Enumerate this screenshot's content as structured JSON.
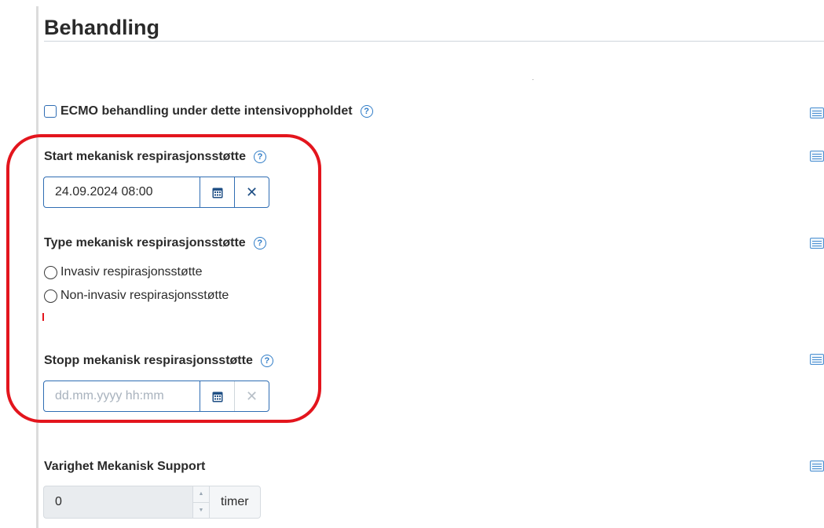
{
  "section": {
    "title": "Behandling"
  },
  "ecmo": {
    "label": "ECMO behandling under dette intensivoppholdet",
    "checked": false
  },
  "start": {
    "label": "Start mekanisk respirasjonsstøtte",
    "value": "24.09.2024 08:00"
  },
  "type": {
    "label": "Type mekanisk respirasjonsstøtte",
    "options": [
      "Invasiv respirasjonsstøtte",
      "Non-invasiv respirasjonsstøtte"
    ]
  },
  "stop": {
    "label": "Stopp mekanisk respirasjonsstøtte",
    "placeholder": "dd.mm.yyyy hh:mm",
    "value": ""
  },
  "duration": {
    "label": "Varighet Mekanisk Support",
    "value": "0",
    "unit": "timer"
  },
  "icons": {
    "help": "help-circle-icon",
    "calendar": "calendar-icon",
    "clear": "close-icon",
    "list": "list-icon"
  },
  "colors": {
    "accent": "#2f6db3",
    "help": "#2f7cc7",
    "annotation": "#e3151d"
  }
}
